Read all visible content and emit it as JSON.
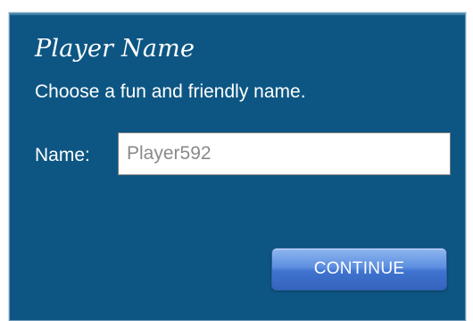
{
  "dialog": {
    "title": "Player Name",
    "subtitle": "Choose a fun and friendly name.",
    "name_label": "Name:",
    "name_value": "Player592",
    "continue_label": "CONTINUE"
  },
  "colors": {
    "panel_background": "#0d5683",
    "button_blue": "#4a7fd6",
    "text": "#ffffff",
    "input_text": "#8a8a8a"
  }
}
